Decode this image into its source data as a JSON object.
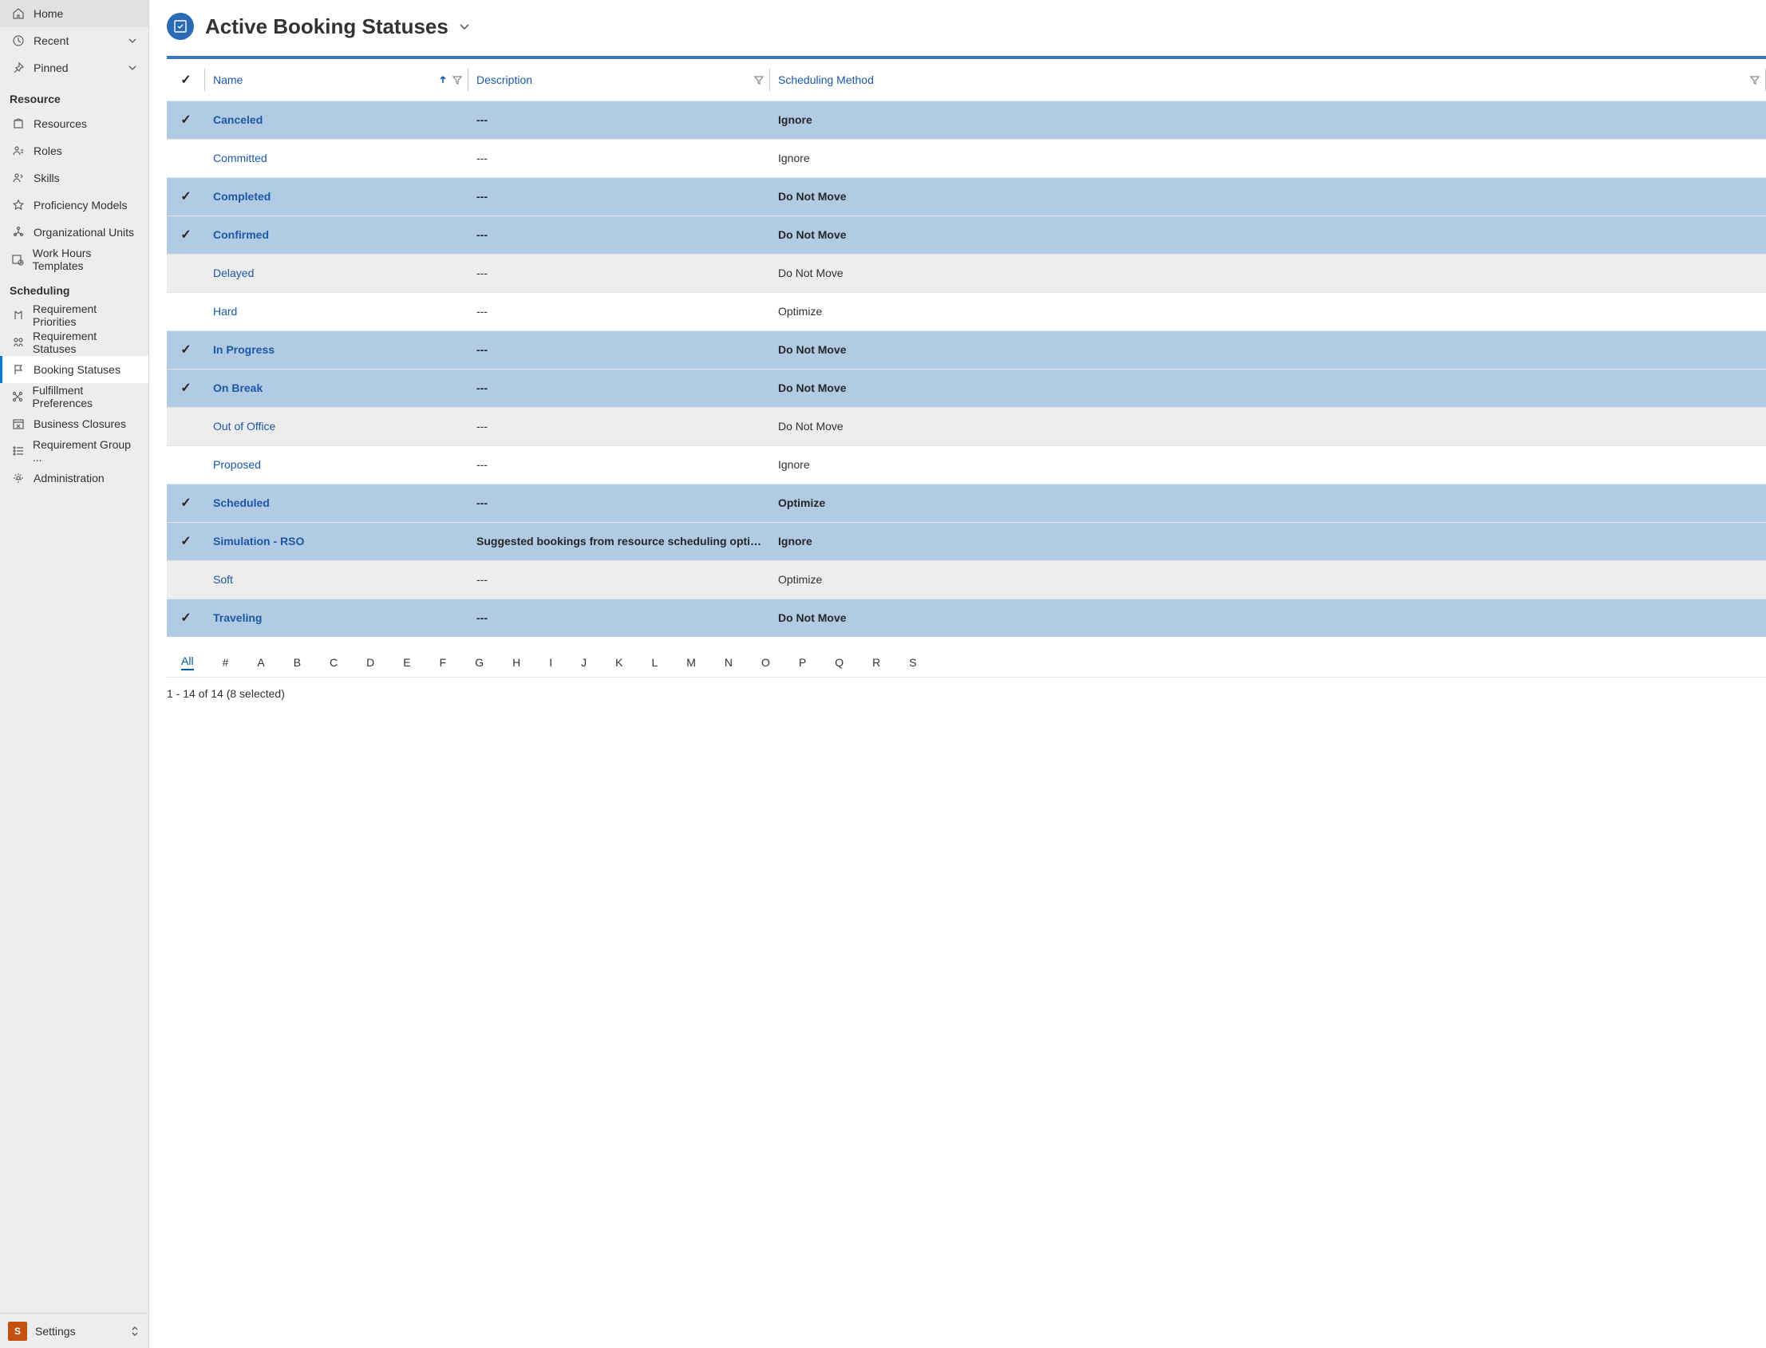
{
  "sidebar": {
    "top": {
      "home": "Home",
      "recent": "Recent",
      "pinned": "Pinned"
    },
    "resource": {
      "title": "Resource",
      "items": [
        "Resources",
        "Roles",
        "Skills",
        "Proficiency Models",
        "Organizational Units",
        "Work Hours Templates"
      ]
    },
    "scheduling": {
      "title": "Scheduling",
      "items": [
        "Requirement Priorities",
        "Requirement Statuses",
        "Booking Statuses",
        "Fulfillment Preferences",
        "Business Closures",
        "Requirement Group ...",
        "Administration"
      ]
    },
    "footer": {
      "tile": "S",
      "label": "Settings"
    }
  },
  "header": {
    "title": "Active Booking Statuses"
  },
  "columns": {
    "name": "Name",
    "description": "Description",
    "method": "Scheduling Method"
  },
  "rows": [
    {
      "selected": true,
      "name": "Canceled",
      "description": "---",
      "method": "Ignore"
    },
    {
      "selected": false,
      "name": "Committed",
      "description": "---",
      "method": "Ignore"
    },
    {
      "selected": true,
      "name": "Completed",
      "description": "---",
      "method": "Do Not Move"
    },
    {
      "selected": true,
      "name": "Confirmed",
      "description": "---",
      "method": "Do Not Move"
    },
    {
      "selected": false,
      "name": "Delayed",
      "description": "---",
      "method": "Do Not Move"
    },
    {
      "selected": false,
      "name": "Hard",
      "description": "---",
      "method": "Optimize"
    },
    {
      "selected": true,
      "name": "In Progress",
      "description": "---",
      "method": "Do Not Move"
    },
    {
      "selected": true,
      "name": "On Break",
      "description": "---",
      "method": "Do Not Move"
    },
    {
      "selected": false,
      "name": "Out of Office",
      "description": "---",
      "method": "Do Not Move"
    },
    {
      "selected": false,
      "name": "Proposed",
      "description": "---",
      "method": "Ignore"
    },
    {
      "selected": true,
      "name": "Scheduled",
      "description": "---",
      "method": "Optimize"
    },
    {
      "selected": true,
      "name": "Simulation - RSO",
      "description": "Suggested bookings from resource scheduling optimiz...",
      "method": "Ignore"
    },
    {
      "selected": false,
      "name": "Soft",
      "description": "---",
      "method": "Optimize"
    },
    {
      "selected": true,
      "name": "Traveling",
      "description": "---",
      "method": "Do Not Move"
    }
  ],
  "filter_bar": [
    "All",
    "#",
    "A",
    "B",
    "C",
    "D",
    "E",
    "F",
    "G",
    "H",
    "I",
    "J",
    "K",
    "L",
    "M",
    "N",
    "O",
    "P",
    "Q",
    "R",
    "S"
  ],
  "record_count": "1 - 14 of 14 (8 selected)"
}
